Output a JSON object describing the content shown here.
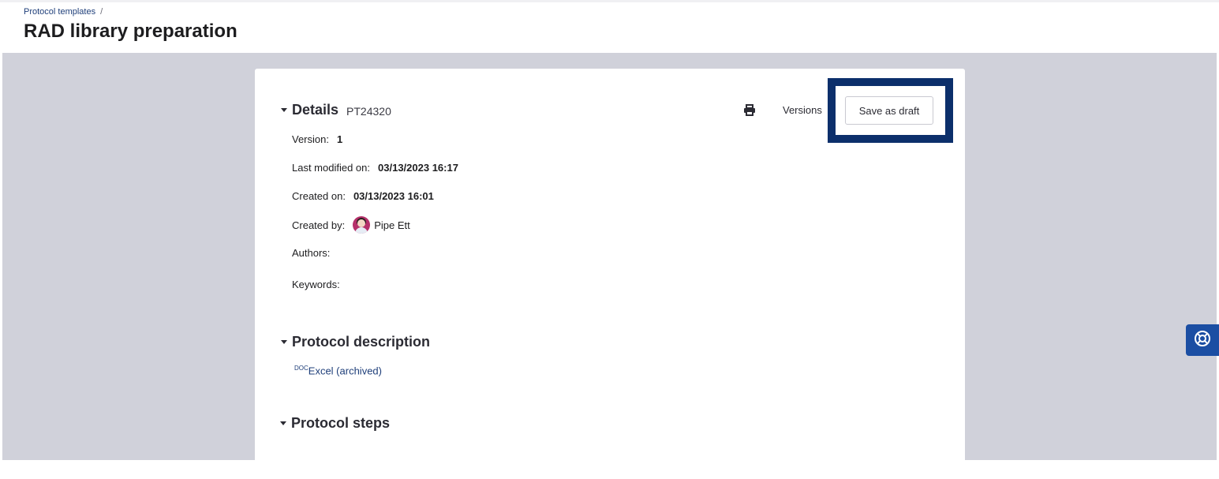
{
  "breadcrumb": {
    "parent": "Protocol templates",
    "separator": "/"
  },
  "page": {
    "title": "RAD library preparation"
  },
  "details": {
    "heading": "Details",
    "id": "PT24320",
    "print_icon": "print-icon",
    "versions_label": "Versions",
    "save_draft_label": "Save as draft",
    "rows": {
      "version": {
        "label": "Version:",
        "value": "1"
      },
      "last_modified": {
        "label": "Last modified on:",
        "value": "03/13/2023 16:17"
      },
      "created_on": {
        "label": "Created on:",
        "value": "03/13/2023 16:01"
      },
      "created_by": {
        "label": "Created by:",
        "value": "Pipe Ett"
      },
      "authors": {
        "label": "Authors:",
        "value": ""
      },
      "keywords": {
        "label": "Keywords:",
        "value": ""
      }
    }
  },
  "description": {
    "heading": "Protocol description",
    "doc_tag": "DOC",
    "link_label": "Excel (archived)"
  },
  "steps": {
    "heading": "Protocol steps"
  },
  "help": {
    "icon": "lifebuoy-icon"
  },
  "colors": {
    "highlight": "#0c2f6b",
    "link": "#1f3f7a",
    "help_button": "#1b4ea3",
    "background": "#d0d1da"
  }
}
